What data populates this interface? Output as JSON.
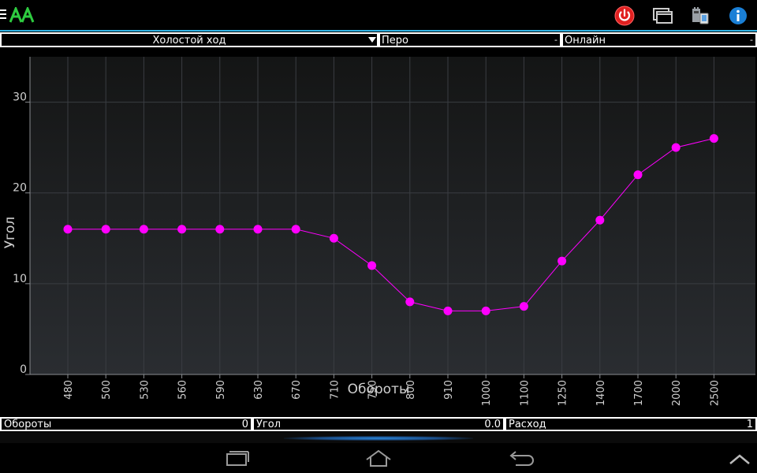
{
  "colors": {
    "accent": "#33b5e5",
    "series": "#ff00ff",
    "grid": "#3a3d42",
    "plot_bg_top": "#141515",
    "plot_bg_bottom": "#2a2d31"
  },
  "icons": [
    "menu-icon",
    "app-logo",
    "power-icon",
    "windows-icon",
    "device-icon",
    "info-icon",
    "recent-apps-icon",
    "home-icon",
    "back-icon",
    "chevron-up-icon"
  ],
  "selectors": {
    "mode": {
      "value": "Холостой ход",
      "icon": "dropdown-arrow"
    },
    "pen": {
      "value": "Перо",
      "indicator": "-"
    },
    "online": {
      "value": "Онлайн",
      "indicator": "-"
    }
  },
  "status": {
    "rpm": {
      "label": "Обороты",
      "value": "0"
    },
    "angle": {
      "label": "Угол",
      "value": "0.0"
    },
    "flow": {
      "label": "Расход",
      "value": "1"
    }
  },
  "chart_data": {
    "type": "line",
    "xlabel": "Обороты",
    "ylabel": "Угол",
    "categories": [
      "480",
      "500",
      "530",
      "560",
      "590",
      "630",
      "670",
      "710",
      "750",
      "800",
      "910",
      "1000",
      "1100",
      "1250",
      "1400",
      "1700",
      "2000",
      "2500"
    ],
    "series": [
      {
        "values": [
          16,
          16,
          16,
          16,
          16,
          16,
          16,
          15,
          12,
          8,
          7,
          7,
          7.5,
          12.5,
          17,
          22,
          25,
          26
        ]
      }
    ],
    "ylim": [
      0,
      35
    ],
    "yticks": [
      "0",
      "10",
      "20",
      "30"
    ],
    "grid": true
  }
}
